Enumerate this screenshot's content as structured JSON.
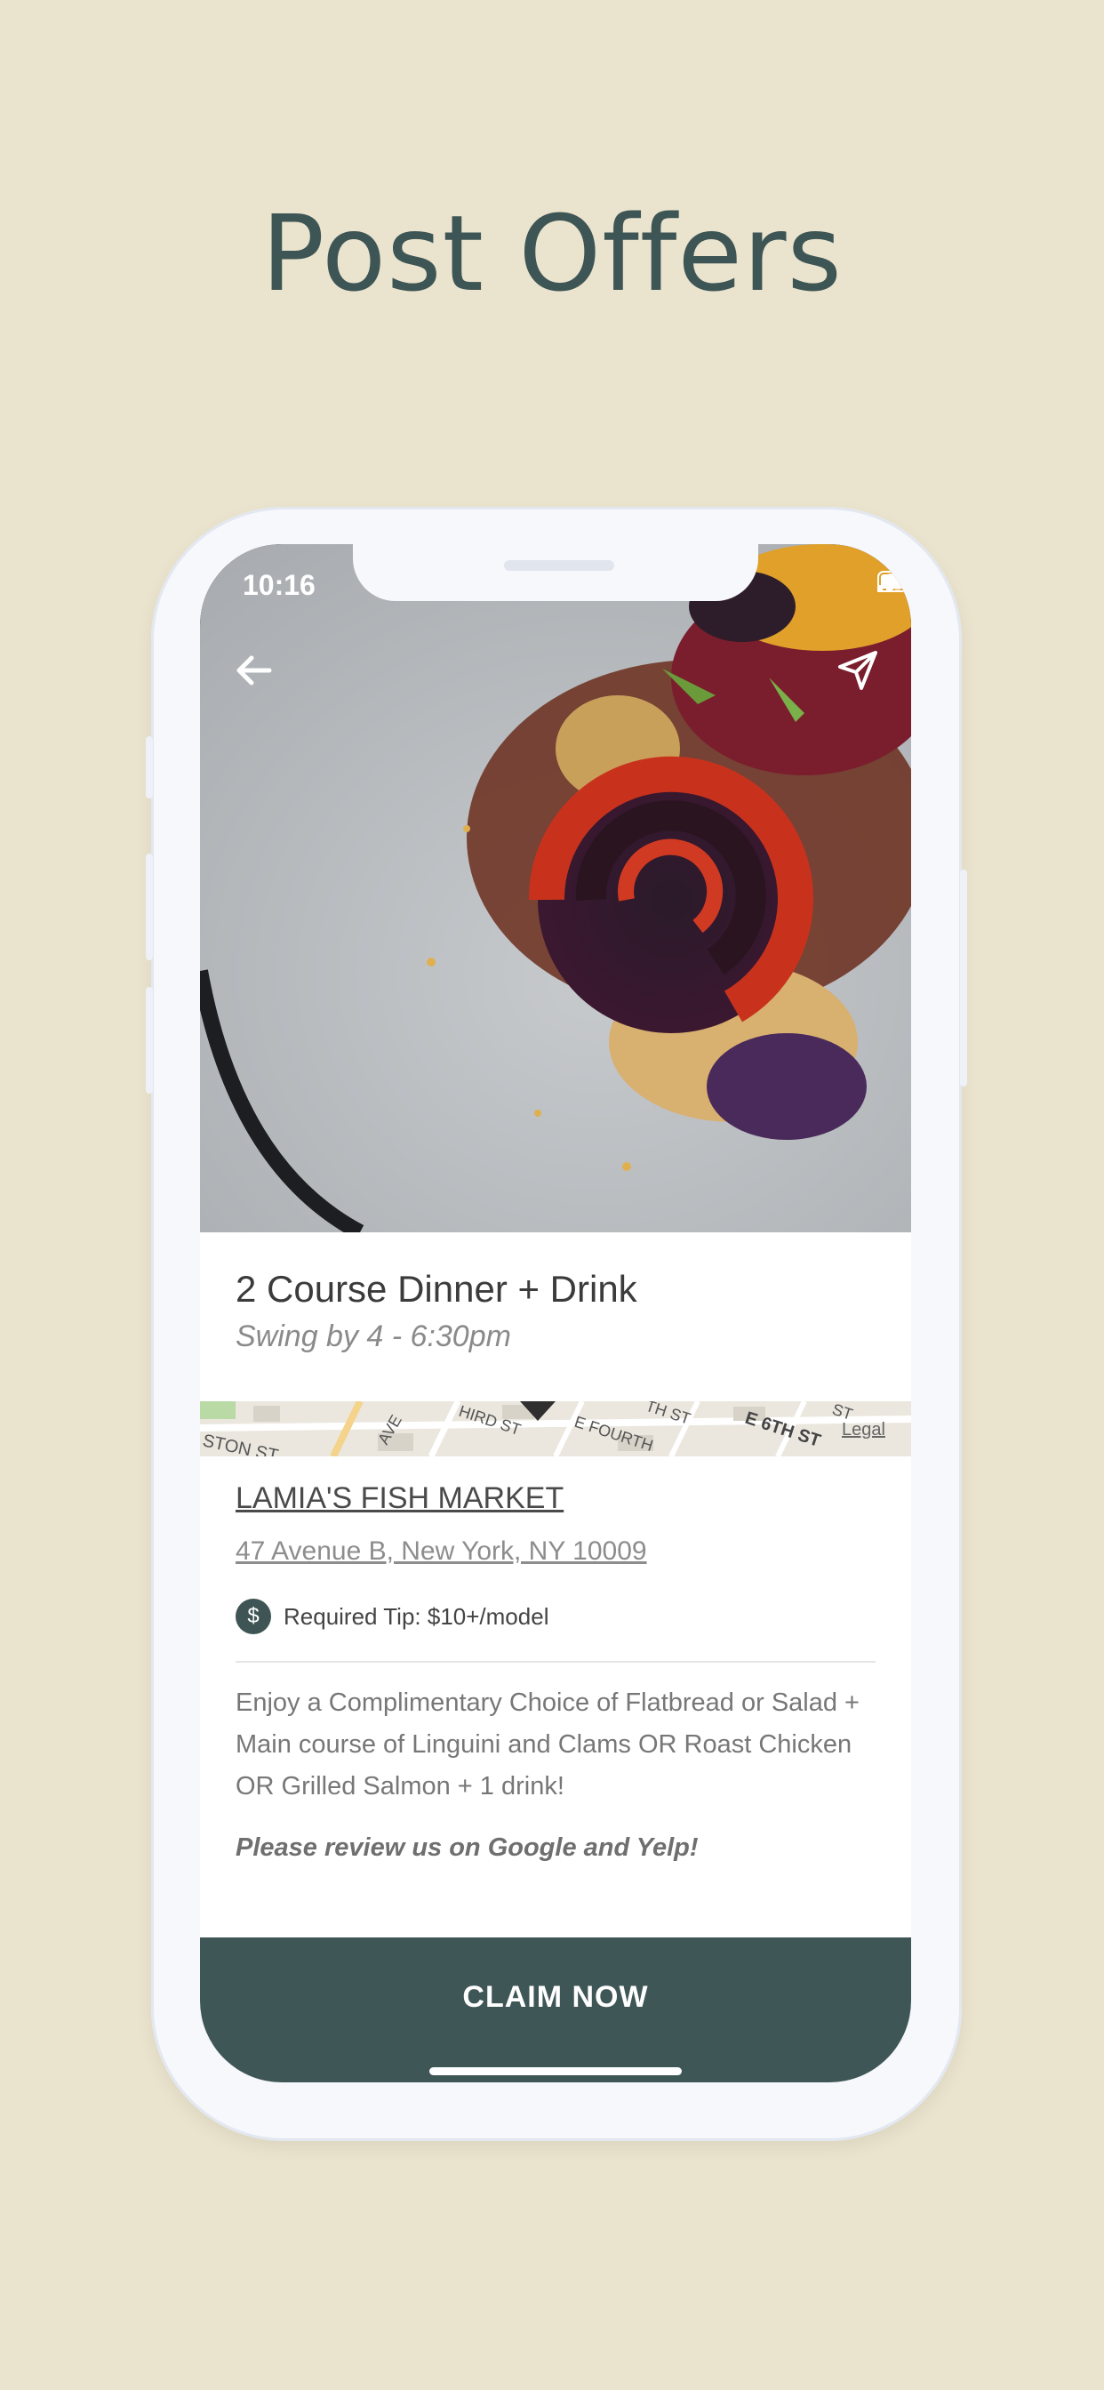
{
  "headline": "Post Offers",
  "status_bar": {
    "time": "10:16"
  },
  "offer": {
    "title": "2 Course Dinner + Drink",
    "subtitle": "Swing by 4 - 6:30pm"
  },
  "map": {
    "legal": "Legal",
    "streets": [
      "STON ST",
      "AVE",
      "HIRD ST",
      "E FOURTH",
      "TH ST",
      "E 6TH ST",
      "ST"
    ]
  },
  "venue": {
    "name": "LAMIA'S FISH MARKET",
    "address": "47 Avenue B, New York, NY 10009"
  },
  "tip": {
    "icon_glyph": "$",
    "label": "Required Tip: $10+/model"
  },
  "description": "Enjoy a Complimentary Choice of Flatbread or Salad + Main course of Linguini and Clams OR Roast Chicken OR Grilled Salmon + 1 drink!",
  "review_note": "Please review us on Google and Yelp!",
  "cta": {
    "label": "CLAIM NOW"
  },
  "colors": {
    "background": "#eae3cd",
    "accent": "#3f5656",
    "headline": "#3e5555"
  }
}
